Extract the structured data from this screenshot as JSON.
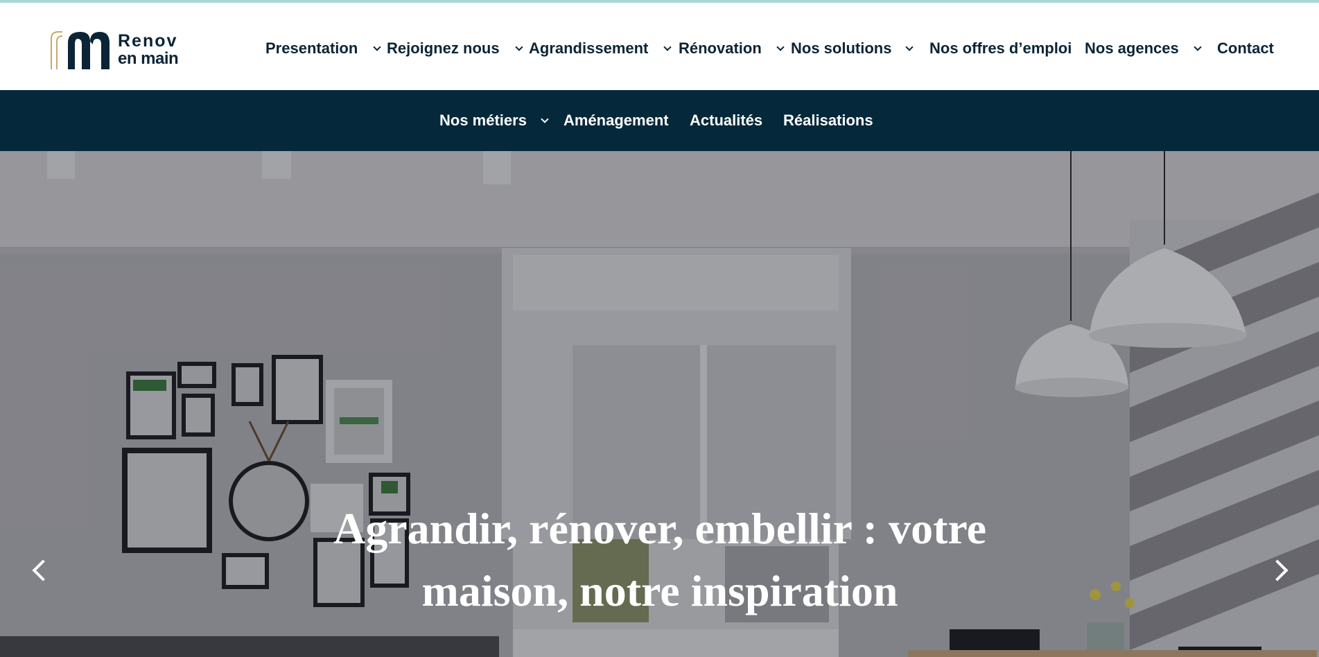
{
  "brand": {
    "logo_line1": "Renov",
    "logo_line2": "en main",
    "navy": "#0b2436",
    "gold": "#c9a86a",
    "accent_strip": "#a9d6d8"
  },
  "main_nav": {
    "items": [
      {
        "label": "Presentation",
        "has_dropdown": true
      },
      {
        "label": "Rejoignez nous",
        "has_dropdown": true
      },
      {
        "label": "Agrandissement",
        "has_dropdown": true
      },
      {
        "label": "Rénovation",
        "has_dropdown": true
      },
      {
        "label": "Nos solutions",
        "has_dropdown": true
      },
      {
        "label": "Nos offres d’emploi",
        "has_dropdown": false
      },
      {
        "label": "Nos agences",
        "has_dropdown": true
      },
      {
        "label": "Contact",
        "has_dropdown": false
      }
    ]
  },
  "sub_nav": {
    "background": "#06283b",
    "items": [
      {
        "label": "Nos métiers",
        "has_dropdown": true
      },
      {
        "label": "Aménagement",
        "has_dropdown": false
      },
      {
        "label": "Actualités",
        "has_dropdown": false
      },
      {
        "label": "Réalisations",
        "has_dropdown": false
      }
    ]
  },
  "hero": {
    "title_line1": "Agrandir, rénover, embellir : votre",
    "title_line2": "maison, notre inspiration",
    "prev_icon": "chevron-left-icon",
    "next_icon": "chevron-right-icon"
  }
}
